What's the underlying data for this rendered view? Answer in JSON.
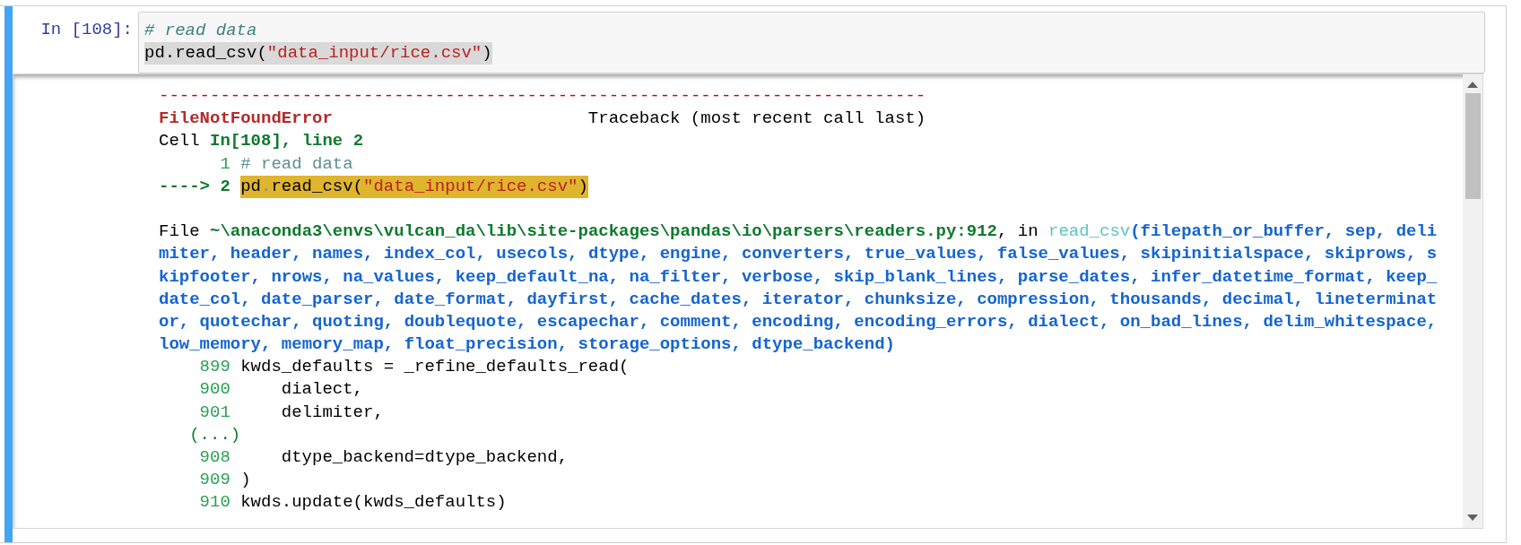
{
  "cell": {
    "prompt": "In [108]:",
    "input": [
      {
        "highlighted": false,
        "segments": [
          {
            "kind": "comment",
            "text": "# read data"
          }
        ]
      },
      {
        "highlighted": true,
        "segments": [
          {
            "kind": "plain",
            "text": "pd.read_csv("
          },
          {
            "kind": "string",
            "text": "\"data_input/rice.csv\""
          },
          {
            "kind": "plain",
            "text": ")"
          }
        ]
      }
    ],
    "output": [
      {
        "kind": "text",
        "segments": [
          {
            "kind": "rule",
            "text": "---------------------------------------------------------------------------"
          }
        ]
      },
      {
        "kind": "text",
        "segments": [
          {
            "kind": "ename",
            "text": "FileNotFoundError"
          },
          {
            "kind": "header",
            "text": "Traceback (most recent call last)"
          }
        ]
      },
      {
        "kind": "text",
        "segments": [
          {
            "kind": "plain",
            "text": "Cell "
          },
          {
            "kind": "location",
            "text": "In[108], line 2"
          }
        ]
      },
      {
        "kind": "code",
        "lineno": "1",
        "current": false,
        "highlighted": false,
        "segments": [
          {
            "kind": "comment",
            "text": "# read data"
          }
        ]
      },
      {
        "kind": "code",
        "arrow": "---->",
        "lineno": "2",
        "current": true,
        "highlighted": true,
        "segments": [
          {
            "kind": "plain",
            "text": "pd"
          },
          {
            "kind": "operator",
            "text": "."
          },
          {
            "kind": "plain",
            "text": "read_csv("
          },
          {
            "kind": "string",
            "text": "\"data_input/rice.csv\""
          },
          {
            "kind": "plain",
            "text": ")"
          }
        ]
      },
      {
        "kind": "blank"
      },
      {
        "kind": "text",
        "segments": [
          {
            "kind": "plain",
            "text": "File "
          },
          {
            "kind": "path",
            "text": "~\\anaconda3\\envs\\vulcan_da\\lib\\site-packages\\pandas\\io\\parsers\\readers.py:912"
          },
          {
            "kind": "plain",
            "text": ", in "
          },
          {
            "kind": "function",
            "text": "read_csv"
          },
          {
            "kind": "signature",
            "text": "(filepath_or_buffer, sep, deli"
          }
        ]
      },
      {
        "kind": "text",
        "segments": [
          {
            "kind": "signature",
            "text": "miter, header, names, index_col, usecols, dtype, engine, converters, true_values, false_values, skipinitialspace, skiprows, s"
          }
        ]
      },
      {
        "kind": "text",
        "segments": [
          {
            "kind": "signature",
            "text": "kipfooter, nrows, na_values, keep_default_na, na_filter, verbose, skip_blank_lines, parse_dates, infer_datetime_format, keep_"
          }
        ]
      },
      {
        "kind": "text",
        "segments": [
          {
            "kind": "signature",
            "text": "date_col, date_parser, date_format, dayfirst, cache_dates, iterator, chunksize, compression, thousands, decimal, lineterminat"
          }
        ]
      },
      {
        "kind": "text",
        "segments": [
          {
            "kind": "signature",
            "text": "or, quotechar, quoting, doublequote, escapechar, comment, encoding, encoding_errors, dialect, on_bad_lines, delim_whitespace,"
          }
        ]
      },
      {
        "kind": "text",
        "segments": [
          {
            "kind": "signature",
            "text": "low_memory, memory_map, float_precision, storage_options, dtype_backend)"
          }
        ]
      },
      {
        "kind": "code",
        "lineno": "899",
        "current": false,
        "highlighted": false,
        "segments": [
          {
            "kind": "plain",
            "text": "kwds_defaults = _refine_defaults_read("
          }
        ]
      },
      {
        "kind": "code",
        "lineno": "900",
        "current": false,
        "highlighted": false,
        "segments": [
          {
            "kind": "plain",
            "text": "    dialect,"
          }
        ]
      },
      {
        "kind": "code",
        "lineno": "901",
        "current": false,
        "highlighted": false,
        "segments": [
          {
            "kind": "plain",
            "text": "    delimiter,"
          }
        ]
      },
      {
        "kind": "ellipsis",
        "text": "(...)"
      },
      {
        "kind": "code",
        "lineno": "908",
        "current": false,
        "highlighted": false,
        "segments": [
          {
            "kind": "plain",
            "text": "    dtype_backend=dtype_backend,"
          }
        ]
      },
      {
        "kind": "code",
        "lineno": "909",
        "current": false,
        "highlighted": false,
        "segments": [
          {
            "kind": "plain",
            "text": ")"
          }
        ]
      },
      {
        "kind": "code",
        "lineno": "910",
        "current": false,
        "highlighted": false,
        "segments": [
          {
            "kind": "plain",
            "text": "kwds.update(kwds_defaults)"
          }
        ]
      }
    ]
  }
}
